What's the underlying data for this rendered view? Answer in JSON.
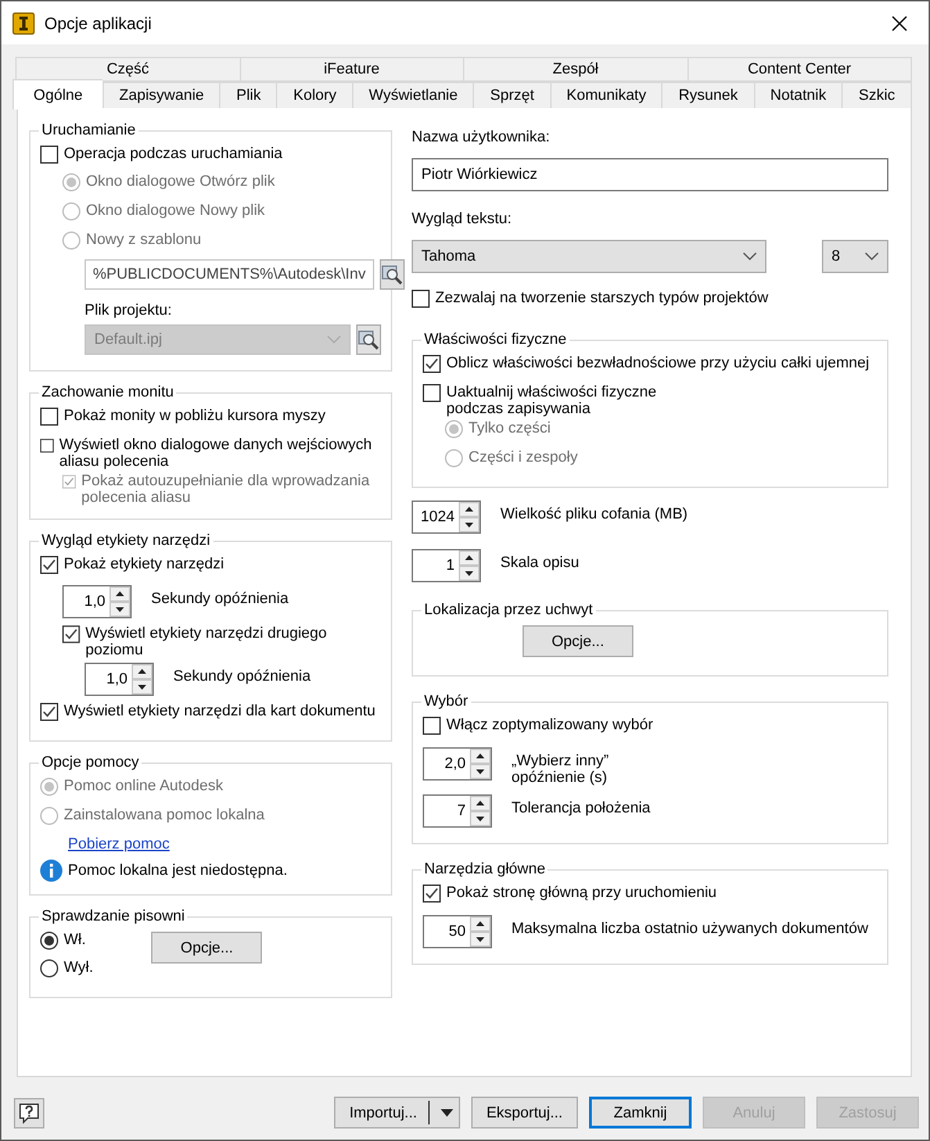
{
  "window": {
    "title": "Opcje aplikacji"
  },
  "tab_rows": [
    {
      "tabs": [
        {
          "label": "Część",
          "selected": false
        },
        {
          "label": "iFeature",
          "selected": false
        },
        {
          "label": "Zespół",
          "selected": false
        },
        {
          "label": "Content Center",
          "selected": false
        }
      ]
    },
    {
      "tabs": [
        {
          "label": "Ogólne",
          "selected": true
        },
        {
          "label": "Zapisywanie",
          "selected": false
        },
        {
          "label": "Plik",
          "selected": false
        },
        {
          "label": "Kolory",
          "selected": false
        },
        {
          "label": "Wyświetlanie",
          "selected": false
        },
        {
          "label": "Sprzęt",
          "selected": false
        },
        {
          "label": "Komunikaty",
          "selected": false
        },
        {
          "label": "Rysunek",
          "selected": false
        },
        {
          "label": "Notatnik",
          "selected": false
        },
        {
          "label": "Szkic",
          "selected": false
        }
      ]
    }
  ],
  "left": [
    {
      "kind": "group",
      "title": "Uruchamianie",
      "items": [
        {
          "kind": "checkbox",
          "label": "Operacja podczas uruchamiania",
          "checked": false,
          "disabled": false,
          "children": [
            {
              "kind": "radio",
              "label": "Okno dialogowe Otwórz plik",
              "selected": true,
              "disabled": true
            },
            {
              "kind": "radio",
              "label": "Okno dialogowe Nowy plik",
              "selected": false,
              "disabled": true
            },
            {
              "kind": "radio",
              "label": "Nowy z szablonu",
              "selected": false,
              "disabled": true,
              "children": [
                {
                  "kind": "field",
                  "value": "%PUBLICDOCUMENTS%\\Autodesk\\Inv",
                  "browse": true
                },
                {
                  "kind": "caption",
                  "text": "Plik projektu:"
                },
                {
                  "kind": "combo",
                  "value": "Default.ipj",
                  "disabled": true,
                  "browse": true
                }
              ]
            }
          ]
        }
      ]
    },
    {
      "kind": "group",
      "title": "Zachowanie monitu",
      "items": [
        {
          "kind": "checkbox",
          "label": "Pokaż monity w pobliżu kursora myszy",
          "checked": false,
          "disabled": false
        },
        {
          "kind": "checkbox",
          "label": "Wyświetl okno dialogowe danych wejściowych aliasu polecenia",
          "checked": false,
          "disabled": false,
          "children": [
            {
              "kind": "checkbox",
              "label": "Pokaż autouzupełnianie dla wprowadzania polecenia aliasu",
              "checked": true,
              "disabled": true
            }
          ]
        }
      ]
    },
    {
      "kind": "group",
      "title": "Wygląd etykiety narzędzi",
      "items": [
        {
          "kind": "checkbox",
          "label": "Pokaż etykiety narzędzi",
          "checked": true,
          "disabled": false,
          "children": [
            {
              "kind": "spin",
              "value": "1,0",
              "caption": "Sekundy opóźnienia"
            },
            {
              "kind": "checkbox",
              "label": "Wyświetl etykiety narzędzi drugiego poziomu",
              "checked": true,
              "disabled": false,
              "children": [
                {
                  "kind": "spin",
                  "value": "1,0",
                  "caption": "Sekundy opóźnienia"
                }
              ]
            }
          ]
        },
        {
          "kind": "checkbox",
          "label": "Wyświetl etykiety narzędzi dla kart dokumentu",
          "checked": true,
          "disabled": false
        }
      ]
    },
    {
      "kind": "group",
      "title": "Opcje pomocy",
      "items": [
        {
          "kind": "radio",
          "label": "Pomoc online Autodesk",
          "selected": true,
          "disabled": true
        },
        {
          "kind": "radio",
          "label": "Zainstalowana pomoc lokalna",
          "selected": false,
          "disabled": true,
          "children": [
            {
              "kind": "link",
              "text": "Pobierz pomoc"
            }
          ]
        },
        {
          "kind": "info",
          "text": "Pomoc lokalna jest niedostępna."
        }
      ]
    },
    {
      "kind": "group",
      "title": "Sprawdzanie pisowni",
      "items": [
        {
          "kind": "pair",
          "left": [
            {
              "kind": "radio",
              "label": "Wł.",
              "selected": true,
              "disabled": false
            },
            {
              "kind": "radio",
              "label": "Wył.",
              "selected": false,
              "disabled": false
            }
          ],
          "right": [
            {
              "kind": "button",
              "label": "Opcje..."
            }
          ]
        }
      ]
    }
  ],
  "right": [
    {
      "kind": "caption",
      "text": "Nazwa użytkownika:"
    },
    {
      "kind": "field",
      "value": "Piotr Wiórkiewicz",
      "browse": false
    },
    {
      "kind": "caption",
      "text": "Wygląd tekstu:"
    },
    {
      "kind": "combo_row",
      "combos": [
        {
          "value": "Tahoma",
          "disabled": false
        },
        {
          "value": "8",
          "disabled": false
        }
      ]
    },
    {
      "kind": "checkbox",
      "label": "Zezwalaj na tworzenie starszych typów projektów",
      "checked": false,
      "disabled": false
    },
    {
      "kind": "group",
      "title": "Właściwości fizyczne",
      "items": [
        {
          "kind": "checkbox",
          "label": "Oblicz właściwości bezwładnościowe przy użyciu całki ujemnej",
          "checked": true,
          "disabled": false
        },
        {
          "kind": "checkbox",
          "label": "Uaktualnij właściwości fizyczne\npodczas zapisywania",
          "checked": false,
          "disabled": false,
          "children": [
            {
              "kind": "radio",
              "label": "Tylko części",
              "selected": true,
              "disabled": true
            },
            {
              "kind": "radio",
              "label": "Części i zespoły",
              "selected": false,
              "disabled": true
            }
          ]
        }
      ]
    },
    {
      "kind": "spin",
      "value": "1024",
      "caption": "Wielkość pliku cofania (MB)"
    },
    {
      "kind": "spin",
      "value": "1",
      "caption": "Skala opisu"
    },
    {
      "kind": "group",
      "title": "Lokalizacja przez uchwyt",
      "items": [
        {
          "kind": "button",
          "label": "Opcje..."
        }
      ]
    },
    {
      "kind": "group",
      "title": "Wybór",
      "items": [
        {
          "kind": "checkbox",
          "label": "Włącz zoptymalizowany wybór",
          "checked": false,
          "disabled": false
        },
        {
          "kind": "spin",
          "value": "2,0",
          "caption": "„Wybierz inny”\nopóźnienie (s)"
        },
        {
          "kind": "spin",
          "value": "7",
          "caption": "Tolerancja położenia"
        }
      ]
    },
    {
      "kind": "group",
      "title": "Narzędzia główne",
      "items": [
        {
          "kind": "checkbox",
          "label": "Pokaż stronę główną przy uruchomieniu",
          "checked": true,
          "disabled": false
        },
        {
          "kind": "spin",
          "value": "50",
          "caption": "Maksymalna liczba ostatnio używanych dokumentów"
        }
      ]
    }
  ],
  "footer": {
    "buttons": [
      {
        "kind": "split",
        "label": "Importuj...",
        "default": false,
        "disabled": false
      },
      {
        "kind": "button",
        "label": "Eksportuj...",
        "default": false,
        "disabled": false
      },
      {
        "kind": "button",
        "label": "Zamknij",
        "default": true,
        "disabled": false
      },
      {
        "kind": "button",
        "label": "Anuluj",
        "default": false,
        "disabled": true
      },
      {
        "kind": "button",
        "label": "Zastosuj",
        "default": false,
        "disabled": true
      }
    ]
  }
}
